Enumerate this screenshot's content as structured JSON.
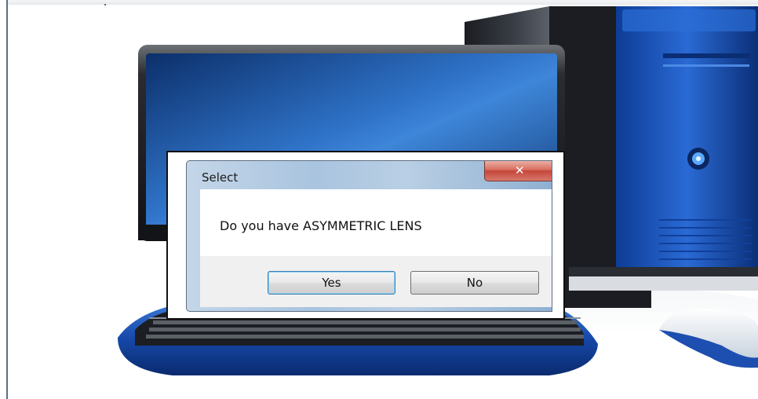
{
  "dialog": {
    "title": "Select",
    "close_symbol": "✕",
    "message": "Do you have ASYMMETRIC LENS",
    "yes_label": "Yes",
    "no_label": "No"
  },
  "colors": {
    "monitor_screen": "#1f57a8",
    "tower_panel": "#1d56b8",
    "dialog_border": "#111111",
    "default_button_border": "#3c7fb1",
    "close_button": "#c4463a"
  },
  "icons": [
    "computer-illustration",
    "close-icon"
  ]
}
